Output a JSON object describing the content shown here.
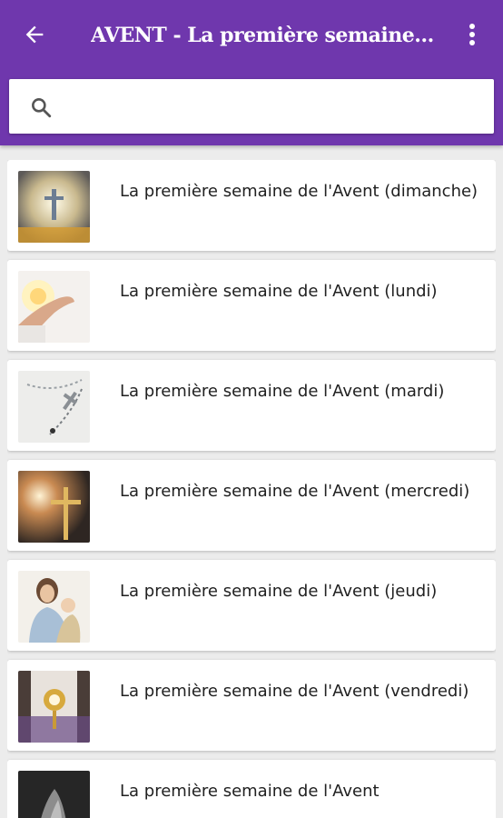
{
  "app_bar": {
    "title": "AVENT - La première semaine de l'Avent",
    "back_icon": "arrow-left-icon",
    "menu_icon": "more-vertical-icon",
    "color": "#6f37ad"
  },
  "search": {
    "icon": "search-icon",
    "value": "",
    "placeholder": ""
  },
  "items": [
    {
      "label": "La première semaine de l'Avent (dimanche)",
      "thumbnail": "cross-in-light-image"
    },
    {
      "label": "La première semaine de l'Avent (lundi)",
      "thumbnail": "hand-with-light-image"
    },
    {
      "label": "La première semaine de l'Avent (mardi)",
      "thumbnail": "rosary-image"
    },
    {
      "label": "La première semaine de l'Avent (mercredi)",
      "thumbnail": "golden-cross-image"
    },
    {
      "label": "La première semaine de l'Avent (jeudi)",
      "thumbnail": "saint-with-child-image"
    },
    {
      "label": "La première semaine de l'Avent (vendredi)",
      "thumbnail": "monstrance-image"
    },
    {
      "label": "La première semaine de l'Avent",
      "thumbnail": "praying-hands-image"
    }
  ]
}
